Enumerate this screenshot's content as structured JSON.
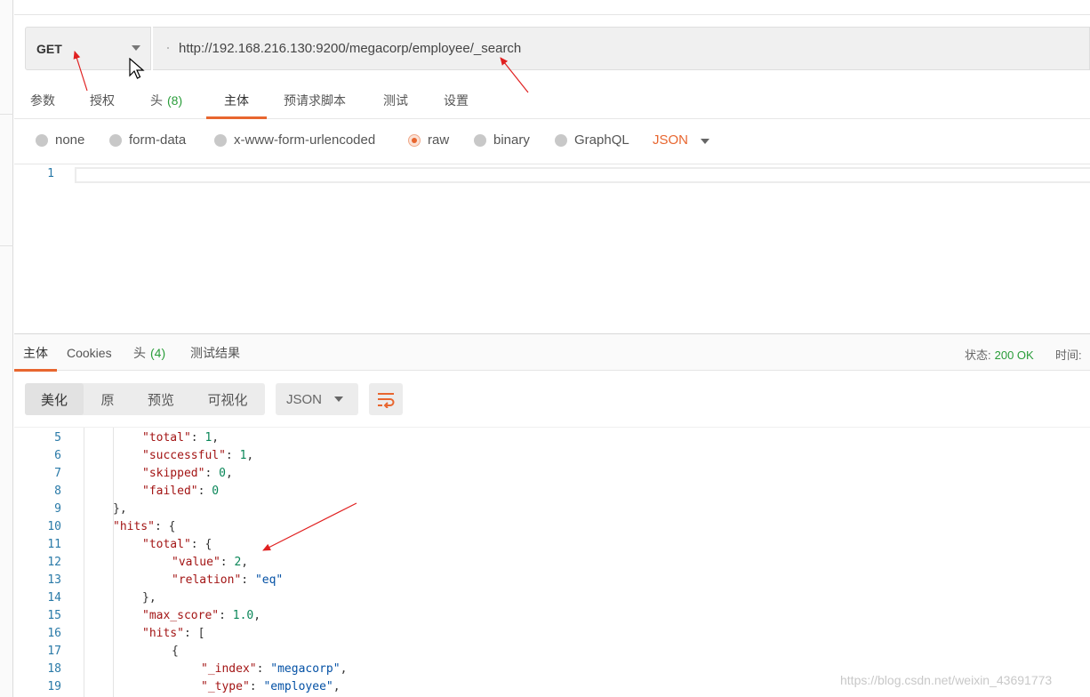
{
  "request": {
    "method": "GET",
    "url": "http://192.168.216.130:9200/megacorp/employee/_search"
  },
  "request_tabs": [
    {
      "label": "参数",
      "count": ""
    },
    {
      "label": "授权",
      "count": ""
    },
    {
      "label": "头",
      "count": "(8)"
    },
    {
      "label": "主体",
      "count": ""
    },
    {
      "label": "预请求脚本",
      "count": ""
    },
    {
      "label": "测试",
      "count": ""
    },
    {
      "label": "设置",
      "count": ""
    }
  ],
  "body_types": [
    "none",
    "form-data",
    "x-www-form-urlencoded",
    "raw",
    "binary",
    "GraphQL"
  ],
  "body_format": "JSON",
  "request_editor": {
    "line": "1"
  },
  "response_tabs": [
    {
      "label": "主体",
      "count": ""
    },
    {
      "label": "Cookies",
      "count": ""
    },
    {
      "label": "头",
      "count": "(4)"
    },
    {
      "label": "测试结果",
      "count": ""
    }
  ],
  "response_status": {
    "label": "状态:",
    "value": "200 OK",
    "time_label": "时间:"
  },
  "view_modes": [
    "美化",
    "原",
    "预览",
    "可视化"
  ],
  "response_format": "JSON",
  "response_lines": [
    {
      "num": "5",
      "tokens": [
        [
          "k",
          "\"total\""
        ],
        [
          "p",
          ": "
        ],
        [
          "n",
          "1"
        ],
        [
          "p",
          ","
        ]
      ]
    },
    {
      "num": "6",
      "tokens": [
        [
          "k",
          "\"successful\""
        ],
        [
          "p",
          ": "
        ],
        [
          "n",
          "1"
        ],
        [
          "p",
          ","
        ]
      ]
    },
    {
      "num": "7",
      "tokens": [
        [
          "k",
          "\"skipped\""
        ],
        [
          "p",
          ": "
        ],
        [
          "n",
          "0"
        ],
        [
          "p",
          ","
        ]
      ]
    },
    {
      "num": "8",
      "tokens": [
        [
          "k",
          "\"failed\""
        ],
        [
          "p",
          ": "
        ],
        [
          "n",
          "0"
        ]
      ]
    },
    {
      "num": "9",
      "tokens": [
        [
          "p",
          "},"
        ]
      ]
    },
    {
      "num": "10",
      "tokens": [
        [
          "k",
          "\"hits\""
        ],
        [
          "p",
          ": {"
        ]
      ]
    },
    {
      "num": "11",
      "tokens": [
        [
          "k",
          "\"total\""
        ],
        [
          "p",
          ": {"
        ]
      ]
    },
    {
      "num": "12",
      "tokens": [
        [
          "k",
          "\"value\""
        ],
        [
          "p",
          ": "
        ],
        [
          "n",
          "2"
        ],
        [
          "p",
          ","
        ]
      ]
    },
    {
      "num": "13",
      "tokens": [
        [
          "k",
          "\"relation\""
        ],
        [
          "p",
          ": "
        ],
        [
          "s",
          "\"eq\""
        ]
      ]
    },
    {
      "num": "14",
      "tokens": [
        [
          "p",
          "},"
        ]
      ]
    },
    {
      "num": "15",
      "tokens": [
        [
          "k",
          "\"max_score\""
        ],
        [
          "p",
          ": "
        ],
        [
          "n",
          "1.0"
        ],
        [
          "p",
          ","
        ]
      ]
    },
    {
      "num": "16",
      "tokens": [
        [
          "k",
          "\"hits\""
        ],
        [
          "p",
          ": ["
        ]
      ]
    },
    {
      "num": "17",
      "tokens": [
        [
          "p",
          "{"
        ]
      ]
    },
    {
      "num": "18",
      "tokens": [
        [
          "k",
          "\"_index\""
        ],
        [
          "p",
          ": "
        ],
        [
          "s",
          "\"megacorp\""
        ],
        [
          "p",
          ","
        ]
      ]
    },
    {
      "num": "19",
      "tokens": [
        [
          "k",
          "\"_type\""
        ],
        [
          "p",
          ": "
        ],
        [
          "s",
          "\"employee\""
        ],
        [
          "p",
          ","
        ]
      ]
    }
  ],
  "watermark": "https://blog.csdn.net/weixin_43691773",
  "colors": {
    "accent": "#e8662f",
    "ok": "#2a9d3a",
    "annotation": "#e02020"
  },
  "icons": [
    "caret-down-icon",
    "mouse-cursor-icon",
    "wrap-lines-icon",
    "radio-icon"
  ]
}
